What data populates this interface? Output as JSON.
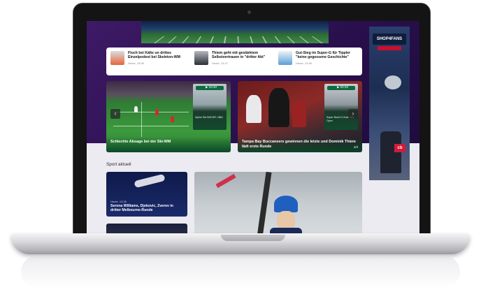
{
  "news_strip": [
    {
      "title": "Fluch bei Kälte un drittes Einzelpodest bei Skeleton-WM",
      "meta": "Heute, 15:05"
    },
    {
      "title": "Thiem geht mit gestärktem Selbstvertrauen in \"dritter Akt\"",
      "meta": "Heute, 14:47"
    },
    {
      "title": "Gut-Sieg im Super-G für Tippler \"keine gegessene Geschichte\"",
      "meta": "Heute, 13:46"
    }
  ],
  "cards": {
    "left": {
      "caption": "Schlechte Absage bei der Ski-WM",
      "inset_play": "▶ 03:40",
      "inset_text": "Alpine Ski-WM NFL NBA",
      "arrow": "‹"
    },
    "right": {
      "caption": "Tampa Bay Buccaneers gewinnen die letzte und Dominik Thiem lädt erste Runde",
      "inset_play": "▶ 02:20",
      "inset_text": "Super Bowl LV Australian Open",
      "arrow": "›",
      "count": "1/3"
    }
  },
  "side_ad": {
    "logo": "SHOP4FANS",
    "tag": "cb"
  },
  "section": {
    "title": "Sport aktuell"
  },
  "small_cards": [
    {
      "meta": "Heute, 13:26",
      "title": "Serena Williams, Djokovic, Zverev in dritter Melbourne-Runde"
    }
  ],
  "colors": {
    "purple": "#2a0f4d",
    "green": "#0e6a3f",
    "ad_blue": "#1d2e52"
  }
}
